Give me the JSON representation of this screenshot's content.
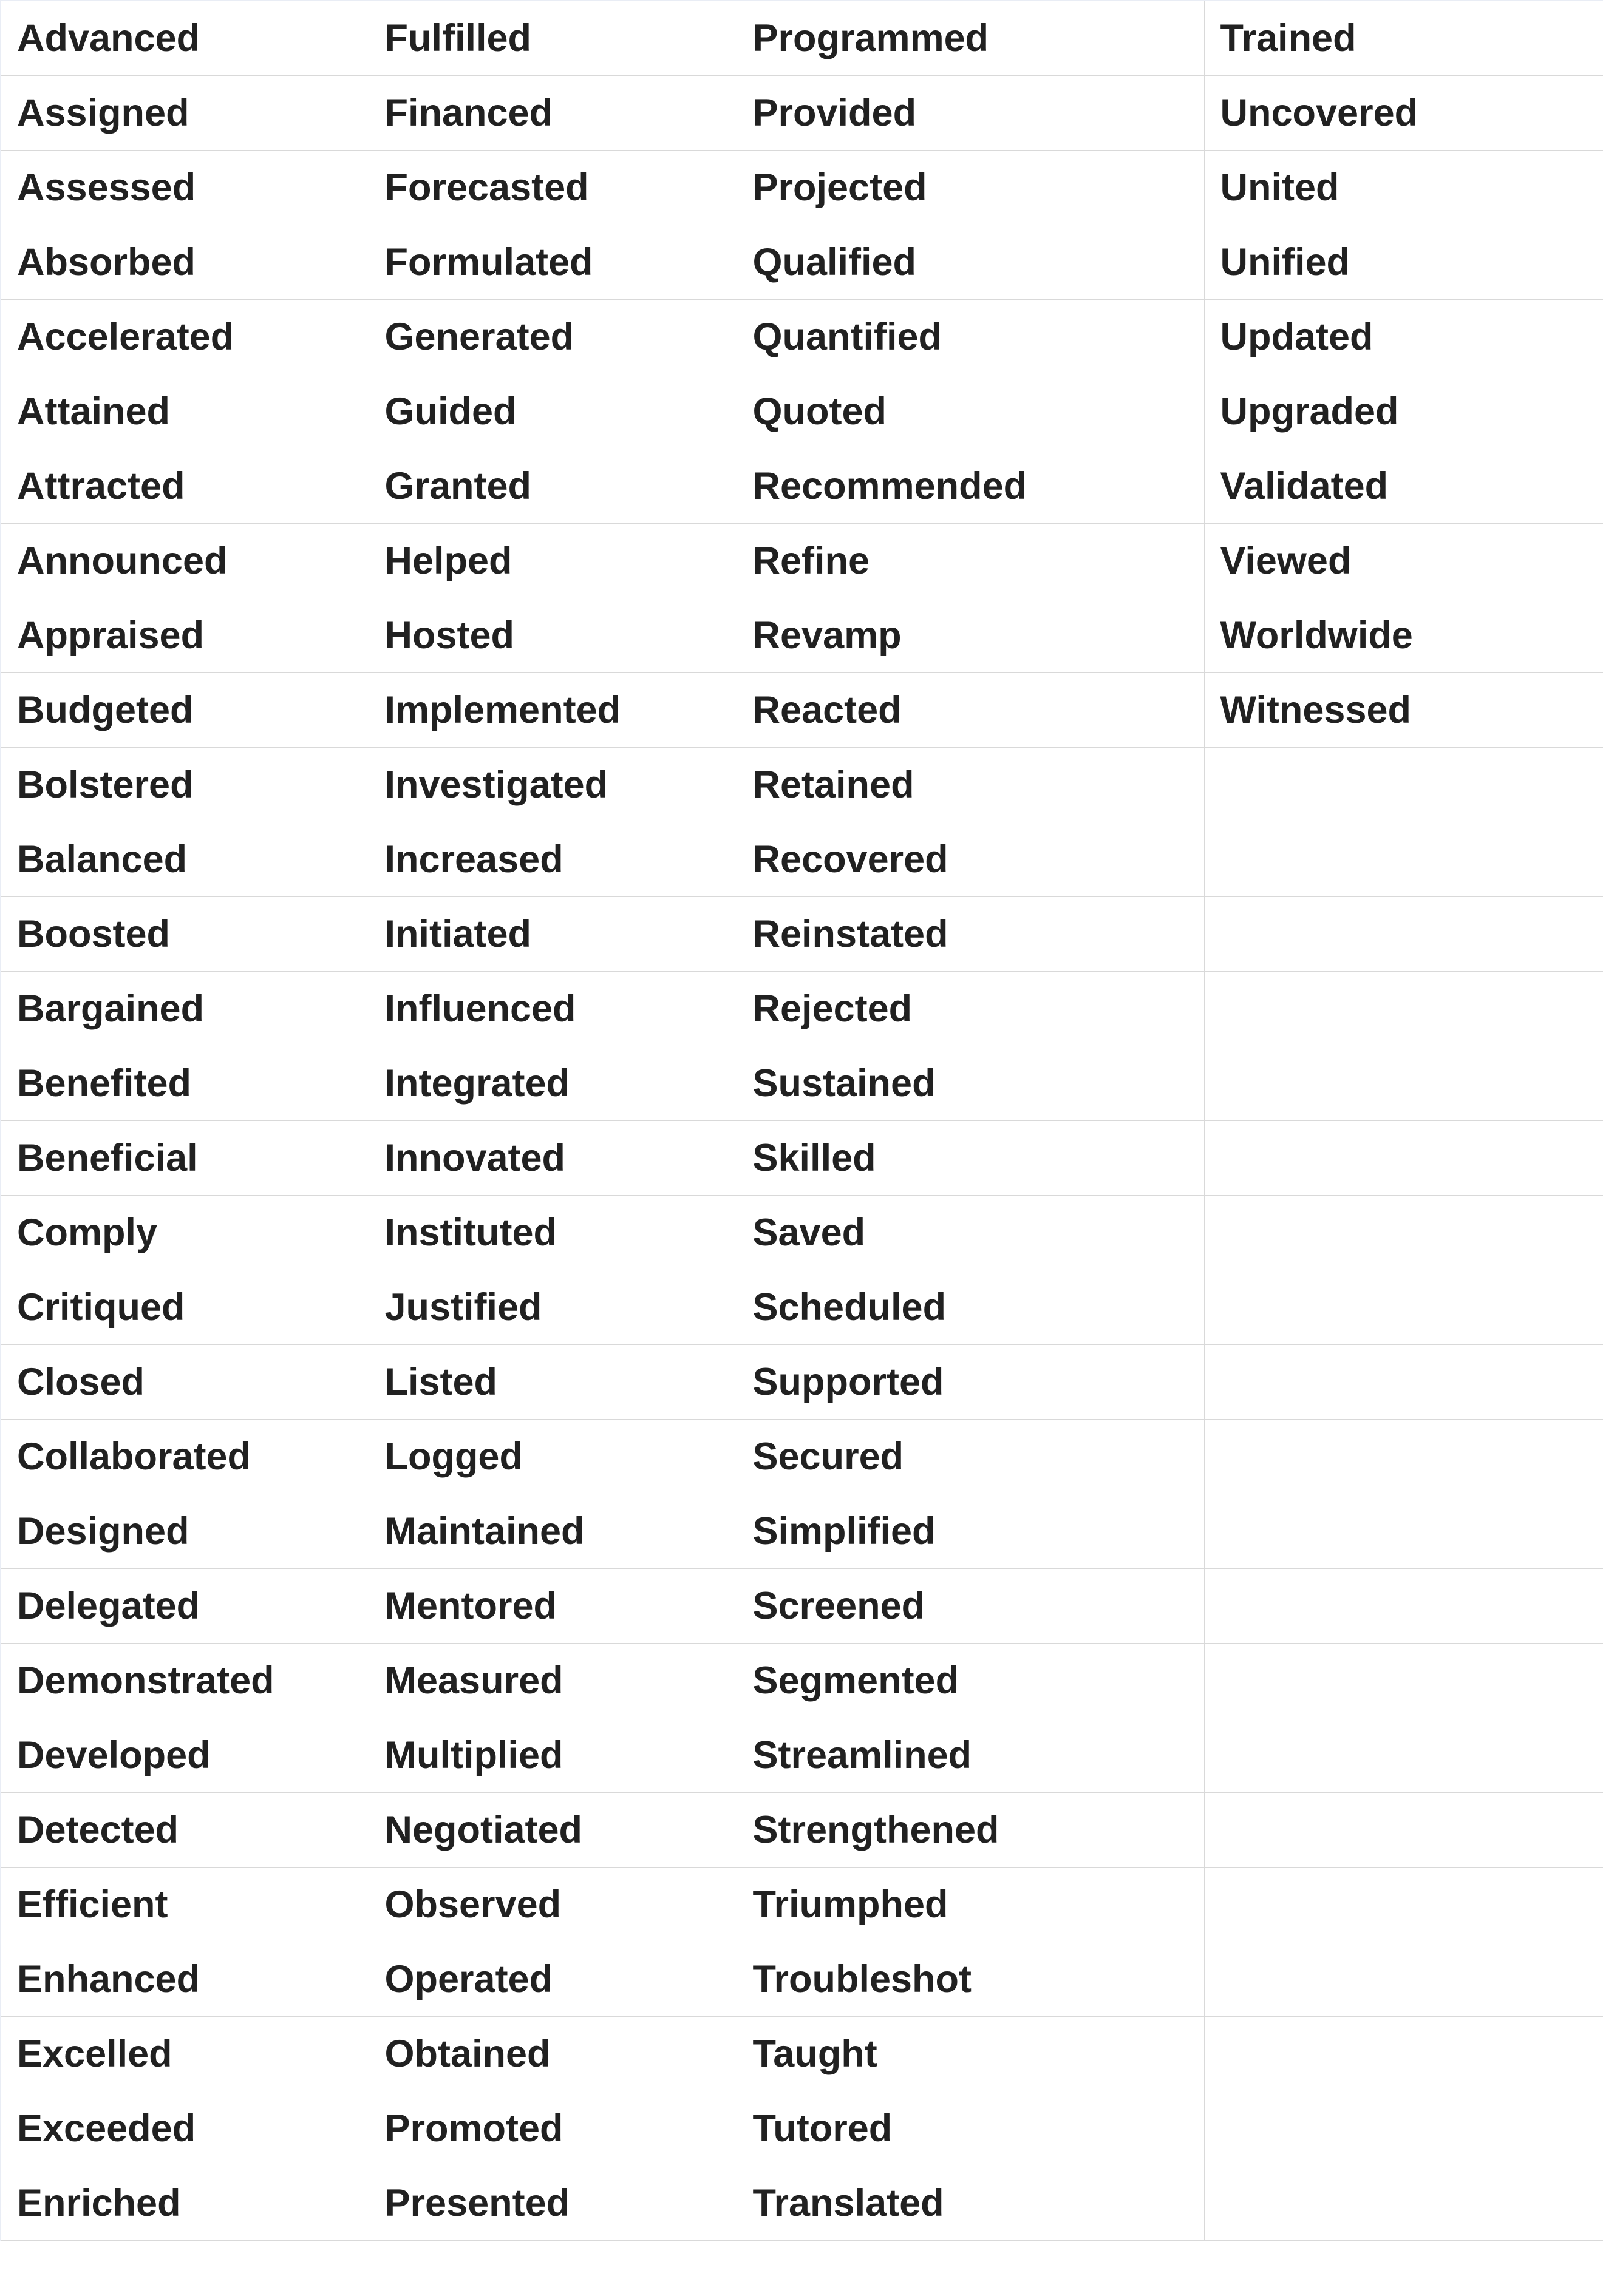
{
  "table": {
    "rows": [
      {
        "c": [
          "Advanced",
          "Fulfilled",
          "Programmed",
          "Trained"
        ]
      },
      {
        "c": [
          "Assigned",
          "Financed",
          "Provided",
          "Uncovered"
        ]
      },
      {
        "c": [
          "Assessed",
          "Forecasted",
          "Projected",
          "United"
        ]
      },
      {
        "c": [
          "Absorbed",
          "Formulated",
          "Qualified",
          "Unified"
        ]
      },
      {
        "c": [
          "Accelerated",
          "Generated",
          "Quantified",
          "Updated"
        ]
      },
      {
        "c": [
          "Attained",
          "Guided",
          "Quoted",
          "Upgraded"
        ]
      },
      {
        "c": [
          "Attracted",
          "Granted",
          "Recommended",
          "Validated"
        ]
      },
      {
        "c": [
          "Announced",
          "Helped",
          "Refine",
          "Viewed"
        ]
      },
      {
        "c": [
          "Appraised",
          "Hosted",
          "Revamp",
          "Worldwide"
        ]
      },
      {
        "c": [
          "Budgeted",
          "Implemented",
          "Reacted",
          "Witnessed"
        ]
      },
      {
        "c": [
          "Bolstered",
          "Investigated",
          "Retained",
          ""
        ]
      },
      {
        "c": [
          "Balanced",
          "Increased",
          "Recovered",
          ""
        ]
      },
      {
        "c": [
          "Boosted",
          "Initiated",
          "Reinstated",
          ""
        ]
      },
      {
        "c": [
          "Bargained",
          "Influenced",
          "Rejected",
          ""
        ]
      },
      {
        "c": [
          "Benefited",
          "Integrated",
          "Sustained",
          ""
        ]
      },
      {
        "c": [
          "Beneficial",
          "Innovated",
          "Skilled",
          ""
        ]
      },
      {
        "c": [
          "Comply",
          "Instituted",
          "Saved",
          ""
        ]
      },
      {
        "c": [
          "Critiqued",
          "Justified",
          "Scheduled",
          ""
        ]
      },
      {
        "c": [
          "Closed",
          "Listed",
          "Supported",
          ""
        ]
      },
      {
        "c": [
          "Collaborated",
          "Logged",
          "Secured",
          ""
        ]
      },
      {
        "c": [
          "Designed",
          "Maintained",
          "Simplified",
          ""
        ]
      },
      {
        "c": [
          "Delegated",
          "Mentored",
          "Screened",
          ""
        ]
      },
      {
        "c": [
          "Demonstrated",
          "Measured",
          "Segmented",
          ""
        ]
      },
      {
        "c": [
          "Developed",
          "Multiplied",
          "Streamlined",
          ""
        ]
      },
      {
        "c": [
          "Detected",
          "Negotiated",
          "Strengthened",
          ""
        ]
      },
      {
        "c": [
          "Efficient",
          "Observed",
          "Triumphed",
          ""
        ]
      },
      {
        "c": [
          "Enhanced",
          "Operated",
          "Troubleshot",
          ""
        ]
      },
      {
        "c": [
          "Excelled",
          "Obtained",
          "Taught",
          ""
        ]
      },
      {
        "c": [
          "Exceeded",
          "Promoted",
          "Tutored",
          ""
        ]
      },
      {
        "c": [
          "Enriched",
          "Presented",
          "Translated",
          ""
        ]
      }
    ]
  }
}
